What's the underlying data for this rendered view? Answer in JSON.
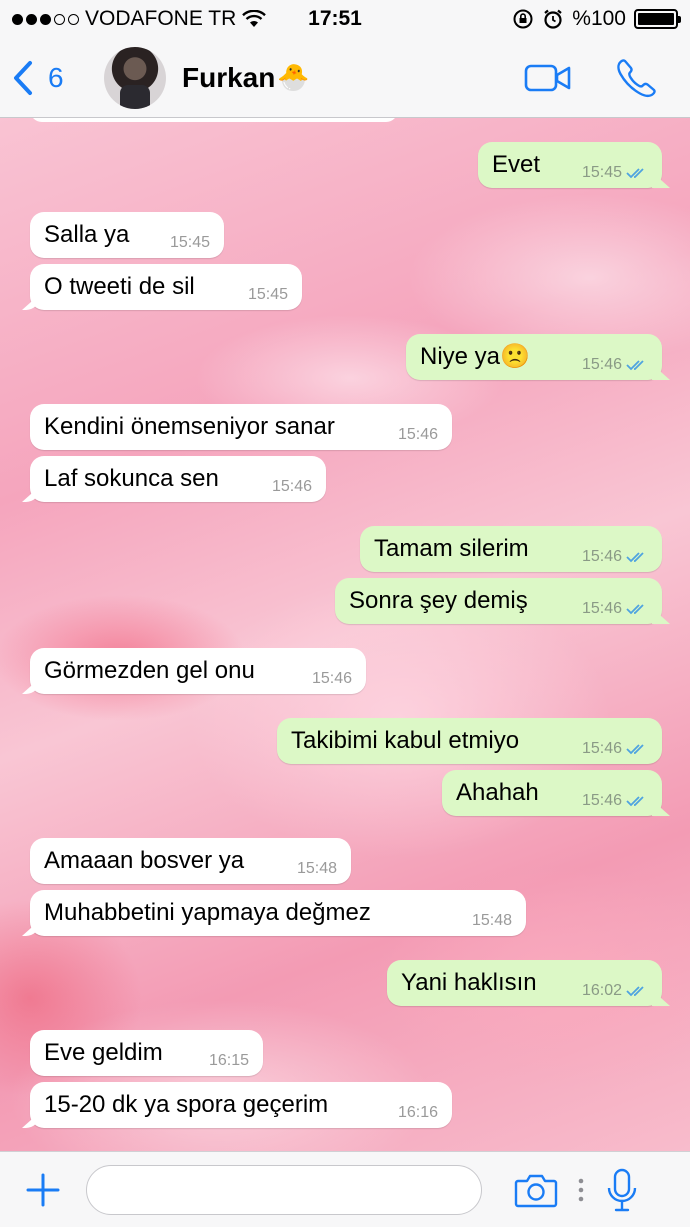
{
  "status": {
    "carrier": "VODAFONE TR",
    "time": "17:51",
    "battery": "%100"
  },
  "header": {
    "back_count": "6",
    "contact_name": "Furkan",
    "contact_emoji": "🐣"
  },
  "messages": [
    {
      "dir": "out",
      "text": "Evet",
      "time": "15:45"
    },
    {
      "dir": "in",
      "text": "Salla ya",
      "time": "15:45"
    },
    {
      "dir": "in",
      "text": "O tweeti de sil",
      "time": "15:45"
    },
    {
      "dir": "out",
      "text": "Niye ya🙁",
      "time": "15:46"
    },
    {
      "dir": "in",
      "text": "Kendini önemseniyor sanar",
      "time": "15:46"
    },
    {
      "dir": "in",
      "text": "Laf sokunca sen",
      "time": "15:46"
    },
    {
      "dir": "out",
      "text": "Tamam silerim",
      "time": "15:46"
    },
    {
      "dir": "out",
      "text": "Sonra şey demiş",
      "time": "15:46"
    },
    {
      "dir": "in",
      "text": "Görmezden gel onu",
      "time": "15:46"
    },
    {
      "dir": "out",
      "text": "Takibimi kabul etmiyo",
      "time": "15:46"
    },
    {
      "dir": "out",
      "text": "Ahahah",
      "time": "15:46"
    },
    {
      "dir": "in",
      "text": "Amaaan bosver ya",
      "time": "15:48"
    },
    {
      "dir": "in",
      "text": "Muhabbetini yapmaya değmez",
      "time": "15:48"
    },
    {
      "dir": "out",
      "text": "Yani haklısın",
      "time": "16:02"
    },
    {
      "dir": "in",
      "text": "Eve geldim",
      "time": "16:15"
    },
    {
      "dir": "in",
      "text": "15-20 dk ya spora geçerim",
      "time": "16:16"
    }
  ],
  "colors": {
    "accent": "#1a7cf5",
    "outgoing_bubble": "#dcf8c6",
    "incoming_bubble": "#ffffff",
    "read_ticks": "#4fa3e0"
  },
  "icons": {
    "back": "chevron-left-icon",
    "video": "video-camera-icon",
    "call": "phone-icon",
    "attach": "plus-icon",
    "camera": "camera-icon",
    "mic": "microphone-icon"
  }
}
